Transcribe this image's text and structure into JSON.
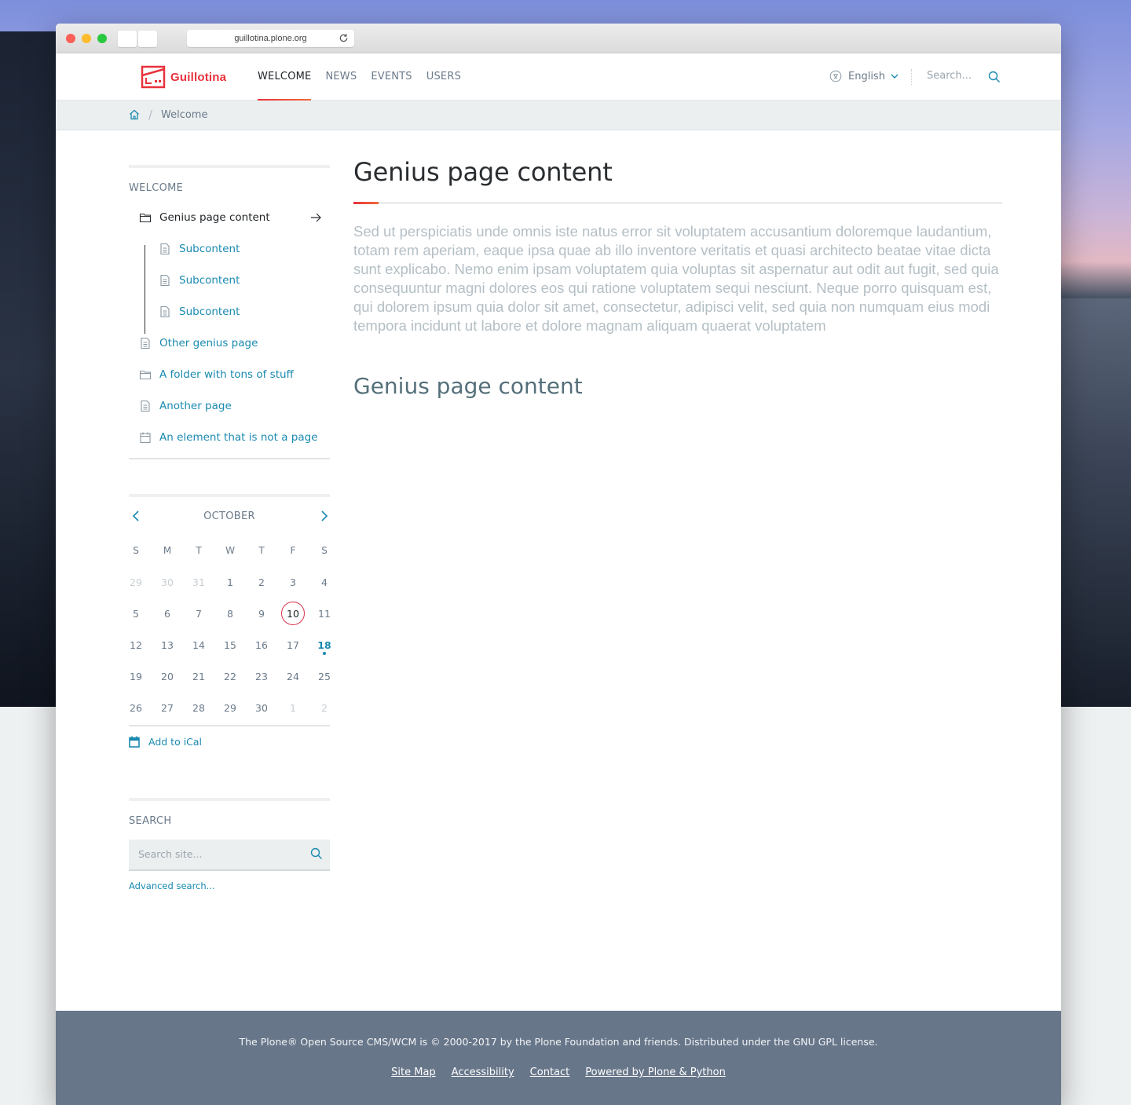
{
  "browser": {
    "url": "guillotina.plone.org"
  },
  "header": {
    "logo_text": "Guillotina",
    "nav": [
      {
        "label": "WELCOME",
        "active": true
      },
      {
        "label": "NEWS",
        "active": false
      },
      {
        "label": "EVENTS",
        "active": false
      },
      {
        "label": "USERS",
        "active": false
      }
    ],
    "language": "English",
    "search_placeholder": "Search..."
  },
  "breadcrumb": {
    "current": "Welcome"
  },
  "sidebar": {
    "nav_title": "WELCOME",
    "items": [
      {
        "label": "Genius page content",
        "icon": "folder-icon",
        "level": 1,
        "current": true
      },
      {
        "label": "Subcontent",
        "icon": "document-icon",
        "level": 2
      },
      {
        "label": "Subcontent",
        "icon": "document-icon",
        "level": 2
      },
      {
        "label": "Subcontent",
        "icon": "document-icon",
        "level": 2
      },
      {
        "label": "Other genius page",
        "icon": "document-icon",
        "level": 1
      },
      {
        "label": "A folder with tons of stuff",
        "icon": "folder-icon",
        "level": 1
      },
      {
        "label": "Another page",
        "icon": "document-icon",
        "level": 1
      },
      {
        "label": "An element that is not a page",
        "icon": "calendar-icon",
        "level": 1
      }
    ],
    "calendar": {
      "month": "OCTOBER",
      "weekdays": [
        "S",
        "M",
        "T",
        "W",
        "T",
        "F",
        "S"
      ],
      "days": [
        {
          "d": "29",
          "muted": true
        },
        {
          "d": "30",
          "muted": true
        },
        {
          "d": "31",
          "muted": true
        },
        {
          "d": "1"
        },
        {
          "d": "2"
        },
        {
          "d": "3"
        },
        {
          "d": "4"
        },
        {
          "d": "5"
        },
        {
          "d": "6"
        },
        {
          "d": "7"
        },
        {
          "d": "8"
        },
        {
          "d": "9"
        },
        {
          "d": "10",
          "today": true
        },
        {
          "d": "11"
        },
        {
          "d": "12"
        },
        {
          "d": "13"
        },
        {
          "d": "14"
        },
        {
          "d": "15"
        },
        {
          "d": "16"
        },
        {
          "d": "17"
        },
        {
          "d": "18",
          "event": true
        },
        {
          "d": "19"
        },
        {
          "d": "20"
        },
        {
          "d": "21"
        },
        {
          "d": "22"
        },
        {
          "d": "23"
        },
        {
          "d": "24"
        },
        {
          "d": "25"
        },
        {
          "d": "26"
        },
        {
          "d": "27"
        },
        {
          "d": "28"
        },
        {
          "d": "29"
        },
        {
          "d": "30"
        },
        {
          "d": "1",
          "muted": true
        },
        {
          "d": "2",
          "muted": true
        }
      ],
      "ical_label": "Add to iCal"
    },
    "search": {
      "title": "SEARCH",
      "placeholder": "Search site...",
      "advanced_label": "Advanced search..."
    }
  },
  "content": {
    "title": "Genius page content",
    "lead": "Sed ut perspiciatis unde omnis iste natus error sit voluptatem accusantium doloremque laudantium, totam rem aperiam, eaque ipsa quae ab illo inventore veritatis et quasi architecto beatae vitae dicta sunt explicabo. Nemo enim ipsam voluptatem quia voluptas sit aspernatur aut odit aut fugit, sed quia consequuntur magni dolores eos qui ratione voluptatem sequi nesciunt. Neque porro quisquam est, qui dolorem ipsum quia dolor sit amet, consectetur, adipisci velit, sed quia non numquam eius modi tempora incidunt ut labore et dolore magnam aliquam quaerat voluptatem",
    "subtitle": "Genius page content"
  },
  "footer": {
    "text": "The Plone® Open Source CMS/WCM is © 2000-2017 by the Plone Foundation and friends. Distributed under the GNU GPL license.",
    "links": [
      "Site Map",
      "Accessibility",
      "Contact",
      "Powered by Plone & Python"
    ]
  },
  "colors": {
    "brand": "#e8323c",
    "link": "#1a8ab0",
    "footer_bg": "#68768a"
  }
}
